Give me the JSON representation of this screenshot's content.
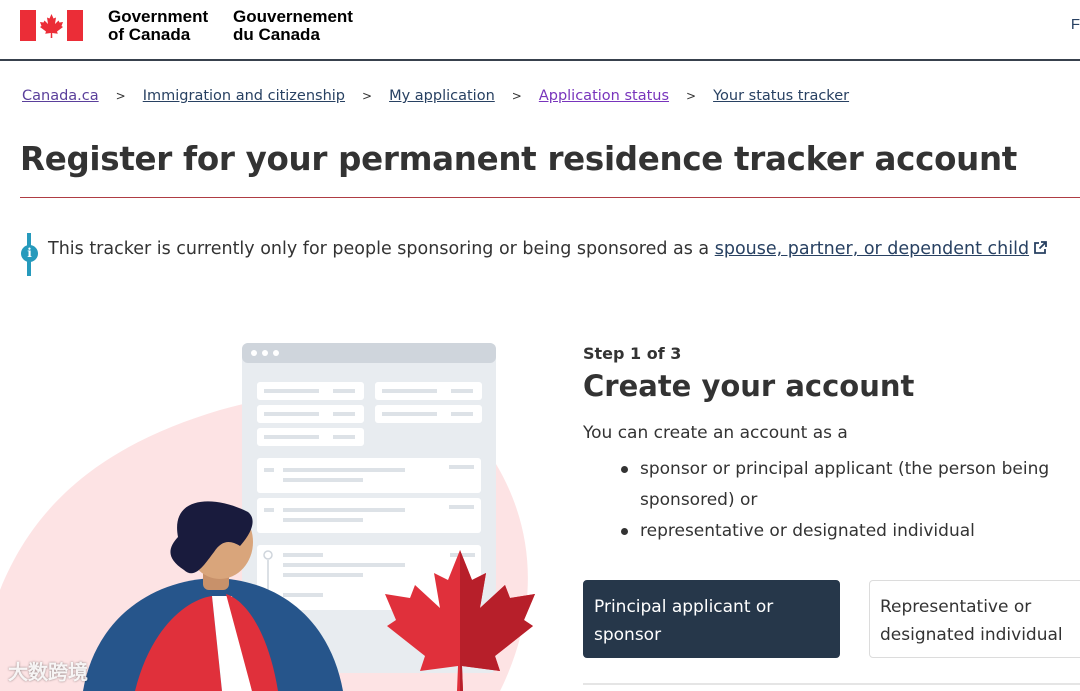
{
  "header": {
    "signature_en_line1": "Government",
    "signature_en_line2": "of Canada",
    "signature_fr_line1": "Gouvernement",
    "signature_fr_line2": "du Canada",
    "language_toggle": "F"
  },
  "breadcrumb": [
    {
      "label": "Canada.ca"
    },
    {
      "label": "Immigration and citizenship"
    },
    {
      "label": "My application"
    },
    {
      "label": "Application status"
    },
    {
      "label": "Your status tracker"
    }
  ],
  "breadcrumb_separator": ">",
  "page": {
    "title": "Register for your permanent residence tracker account"
  },
  "notice": {
    "icon": "info-icon",
    "text": "This tracker is currently only for people sponsoring or being sponsored as a ",
    "link": "spouse, partner, or dependent child"
  },
  "step": {
    "label": "Step 1 of 3",
    "title": "Create your account",
    "intro": "You can create an account as a",
    "options": [
      "sponsor or principal applicant (the person being sponsored) or",
      "representative or designated individual"
    ]
  },
  "buttons": {
    "principal": "Principal applicant or sponsor",
    "representative": "Representative or designated individual"
  },
  "watermark": "大数跨境",
  "colors": {
    "header_rule": "#38414d",
    "title_rule": "#af3c43",
    "info_accent": "#269abc",
    "link": "#284162",
    "visited_link": "#7834bc",
    "primary_button": "#26374a",
    "flag_red": "#eb2d37"
  }
}
